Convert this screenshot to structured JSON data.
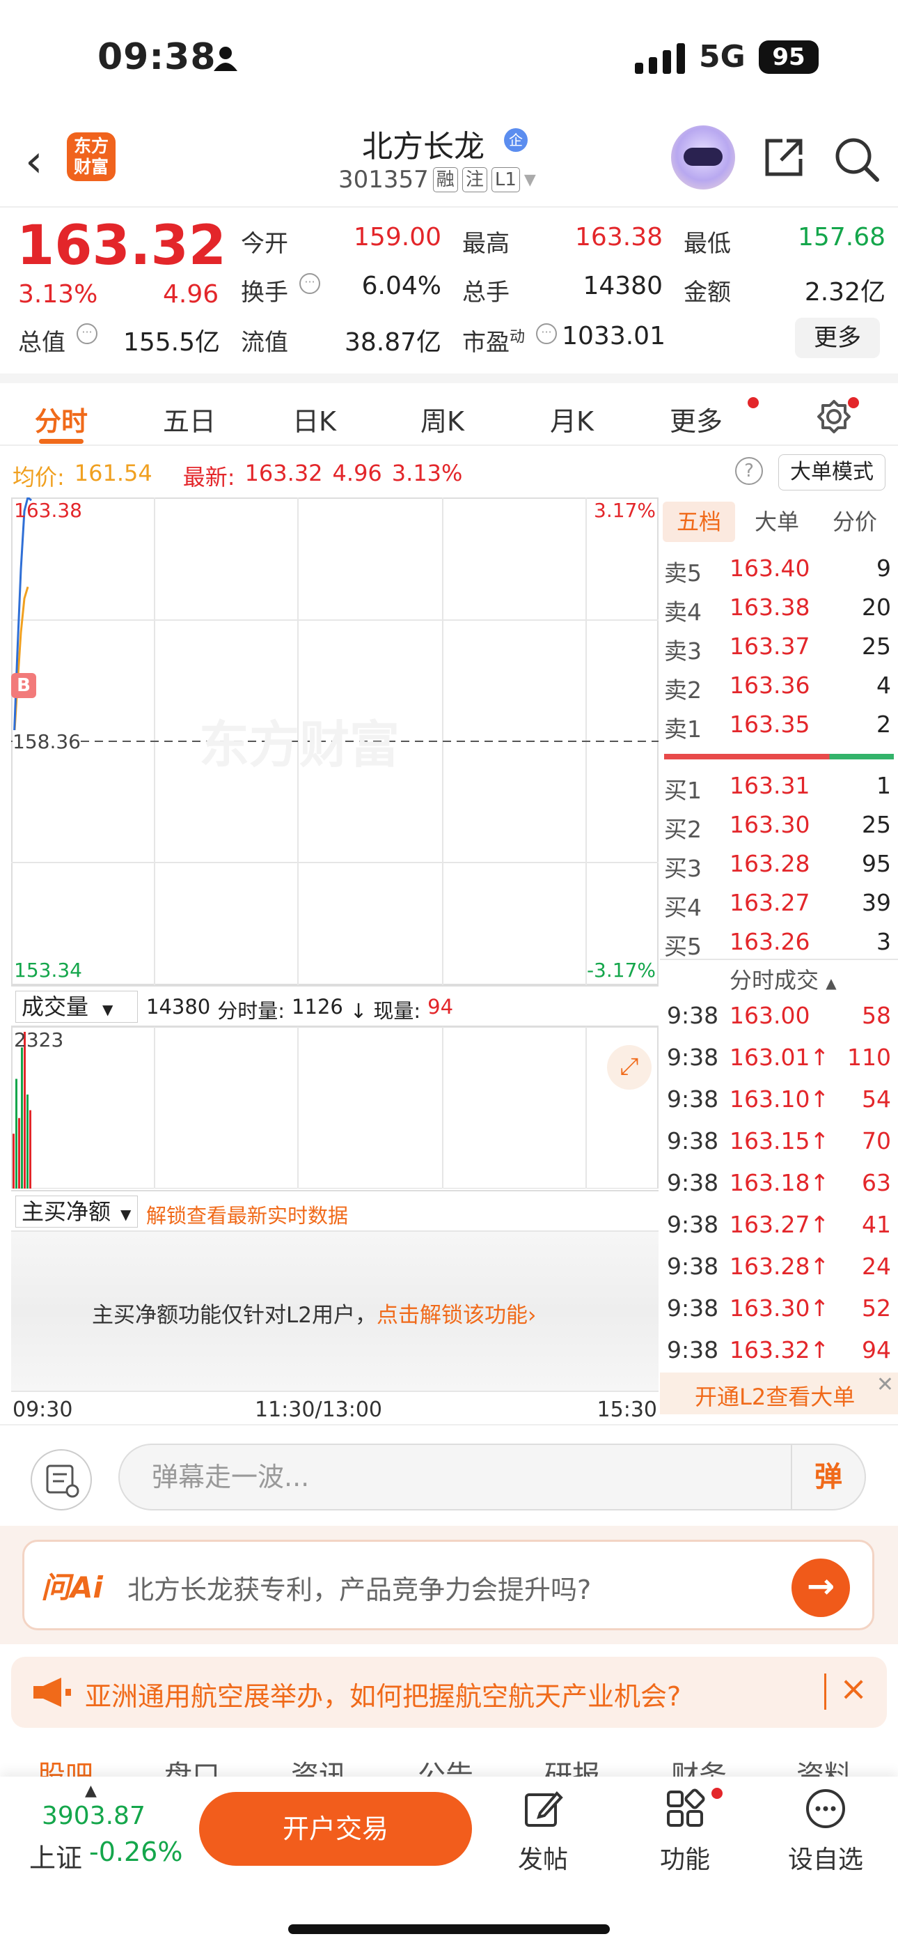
{
  "status": {
    "time": "09:38",
    "network": "5G",
    "battery": "95"
  },
  "header": {
    "back_icon": "‹",
    "logo_line1": "东方",
    "logo_line2": "财富",
    "stock_name": "北方长龙",
    "qiye_badge": "企",
    "code": "301357",
    "tags": [
      "融",
      "注",
      "L1"
    ]
  },
  "quote": {
    "price": "163.32",
    "pct": "3.13%",
    "change": "4.96",
    "open_label": "今开",
    "open": "159.00",
    "high_label": "最高",
    "high": "163.38",
    "low_label": "最低",
    "low": "157.68",
    "turnover_label": "换手",
    "turnover": "6.04%",
    "volume_label": "总手",
    "volume": "14380",
    "amount_label": "金额",
    "amount": "2.32亿",
    "mktcap_label": "总值",
    "mktcap": "155.5亿",
    "float_label": "流值",
    "float": "38.87亿",
    "pe_label": "市盈",
    "pe_sup": "动",
    "pe": "1033.01",
    "more_button": "更多"
  },
  "tabs": [
    "分时",
    "五日",
    "日K",
    "周K",
    "月K",
    "更多"
  ],
  "inforow": {
    "avg_label": "均价:",
    "avg": "161.54",
    "latest_label": "最新:",
    "latest": "163.32",
    "latest_chg": "4.96",
    "latest_pct": "3.13%",
    "help": "?",
    "big_mode": "大单模式"
  },
  "chart": {
    "top_price": "163.38",
    "mid_price": "158.36",
    "bottom_price": "153.34",
    "top_pct": "3.17%",
    "bottom_pct": "-3.17%",
    "b_marker": "B",
    "watermark": "东方财富"
  },
  "chart_data": {
    "type": "line",
    "series": [
      {
        "values": [
          158.36,
          160.2,
          161.9,
          163.1,
          163.38,
          163.32
        ]
      }
    ],
    "ylim": [
      153.34,
      163.38
    ],
    "avg_series": [
      158.36,
      159.5,
      160.6,
      161.3,
      161.54
    ]
  },
  "book": {
    "tabs": [
      "五档",
      "大单",
      "分价"
    ],
    "sells": [
      {
        "label": "卖5",
        "price": "163.40",
        "vol": "9"
      },
      {
        "label": "卖4",
        "price": "163.38",
        "vol": "20"
      },
      {
        "label": "卖3",
        "price": "163.37",
        "vol": "25"
      },
      {
        "label": "卖2",
        "price": "163.36",
        "vol": "4"
      },
      {
        "label": "卖1",
        "price": "163.35",
        "vol": "2"
      }
    ],
    "buys": [
      {
        "label": "买1",
        "price": "163.31",
        "vol": "1"
      },
      {
        "label": "买2",
        "price": "163.30",
        "vol": "25"
      },
      {
        "label": "买3",
        "price": "163.28",
        "vol": "95"
      },
      {
        "label": "买4",
        "price": "163.27",
        "vol": "39"
      },
      {
        "label": "买5",
        "price": "163.26",
        "vol": "3"
      }
    ],
    "ticks_title": "分时成交",
    "ticks": [
      {
        "time": "9:38",
        "price": "163.00",
        "vol": "58"
      },
      {
        "time": "9:38",
        "price": "163.01↑",
        "vol": "110"
      },
      {
        "time": "9:38",
        "price": "163.10↑",
        "vol": "54"
      },
      {
        "time": "9:38",
        "price": "163.15↑",
        "vol": "70"
      },
      {
        "time": "9:38",
        "price": "163.18↑",
        "vol": "63"
      },
      {
        "time": "9:38",
        "price": "163.27↑",
        "vol": "41"
      },
      {
        "time": "9:38",
        "price": "163.28↑",
        "vol": "24"
      },
      {
        "time": "9:38",
        "price": "163.30↑",
        "vol": "52"
      },
      {
        "time": "9:38",
        "price": "163.32↑",
        "vol": "94"
      }
    ],
    "l2_banner": "开通L2查看大单"
  },
  "volume": {
    "selector": "成交量",
    "total": "14380",
    "per_label": "分时量:",
    "per": "1126",
    "now_label": "↓ 现量:",
    "now": "94",
    "max": "2323"
  },
  "netbuy": {
    "selector": "主买净额",
    "unlock": "解锁查看最新实时数据",
    "notice": "主买净额功能仅针对L2用户，",
    "notice_link": "点击解锁该功能"
  },
  "timeaxis": [
    "09:30",
    "11:30/13:00",
    "15:30"
  ],
  "danmu": {
    "placeholder": "弹幕走一波...",
    "button": "弹"
  },
  "ai": {
    "logo": "问Ai",
    "question": "北方长龙获专利，产品竞争力会提升吗?"
  },
  "news": {
    "text": "亚洲通用航空展举办，如何把握航空航天产业机会?"
  },
  "bottom_tabs": [
    "股吧",
    "盘口",
    "资讯",
    "公告",
    "研报",
    "财务",
    "资料"
  ],
  "bottom": {
    "index_value": "3903.87",
    "index_name": "上证",
    "index_chg": "-0.26%",
    "trade_button": "开户交易",
    "post_label": "发帖",
    "func_label": "功能",
    "watch_label": "设自选"
  },
  "colors": {
    "up": "#e3262a",
    "down": "#14a64b",
    "accent": "#f06a1a"
  }
}
